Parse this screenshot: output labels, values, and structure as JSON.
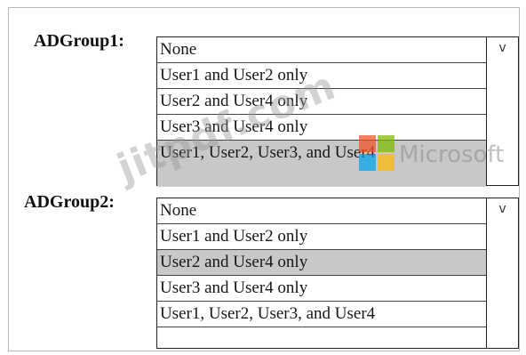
{
  "dropdowns": [
    {
      "label": "ADGroup1:",
      "options": [
        {
          "text": "None",
          "selected": false
        },
        {
          "text": "User1 and User2 only",
          "selected": false
        },
        {
          "text": "User2 and User4 only",
          "selected": false
        },
        {
          "text": "User3 and User4 only",
          "selected": false
        },
        {
          "text": "User1, User2, User3, and User4",
          "selected": true
        }
      ],
      "chevron_icon": "chevron-down-icon"
    },
    {
      "label": "ADGroup2:",
      "options": [
        {
          "text": "None",
          "selected": false
        },
        {
          "text": "User1 and User2 only",
          "selected": false
        },
        {
          "text": "User2 and User4 only",
          "selected": true
        },
        {
          "text": "User3 and User4 only",
          "selected": false
        },
        {
          "text": "User1, User2, User3, and User4",
          "selected": false
        }
      ],
      "chevron_icon": "chevron-down-icon"
    }
  ],
  "chevron_glyph": "v",
  "watermark": {
    "site_text": "jitpdf.com",
    "logo_text": "Microsoft"
  },
  "colors": {
    "selected_row": "#c8c8c8",
    "border": "#222222",
    "logo_red": "#f25022",
    "logo_green": "#7fba00",
    "logo_blue": "#00a4ef",
    "logo_yellow": "#ffb900"
  }
}
